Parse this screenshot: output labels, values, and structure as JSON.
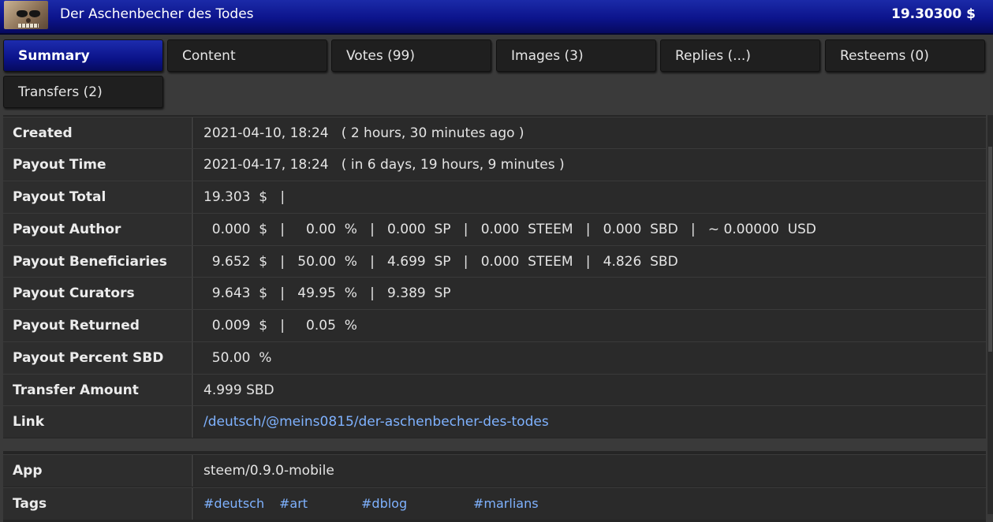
{
  "header": {
    "title": "Der Aschenbecher des Todes",
    "total": "19.30300 $"
  },
  "tabs": [
    {
      "label": "Summary",
      "active": true
    },
    {
      "label": "Content",
      "active": false
    },
    {
      "label": "Votes (99)",
      "active": false
    },
    {
      "label": "Images (3)",
      "active": false
    },
    {
      "label": "Replies (...)",
      "active": false
    },
    {
      "label": "Resteems (0)",
      "active": false
    },
    {
      "label": "Transfers (2)",
      "active": false
    }
  ],
  "summary": [
    {
      "label": "Created",
      "value": "2021-04-10, 18:24   ( 2 hours, 30 minutes ago )"
    },
    {
      "label": "Payout Time",
      "value": "2021-04-17, 18:24   ( in 6 days, 19 hours, 9 minutes )"
    },
    {
      "label": "Payout Total",
      "value": "19.303  $   |"
    },
    {
      "label": "Payout Author",
      "value": "  0.000  $   |     0.00  %   |   0.000  SP   |   0.000  STEEM   |   0.000  SBD   |   ~ 0.00000  USD"
    },
    {
      "label": "Payout Beneficiaries",
      "value": "  9.652  $   |   50.00  %   |   4.699  SP   |   0.000  STEEM   |   4.826  SBD"
    },
    {
      "label": "Payout Curators",
      "value": "  9.643  $   |   49.95  %   |   9.389  SP"
    },
    {
      "label": "Payout Returned",
      "value": "  0.009  $   |     0.05  %"
    },
    {
      "label": "Payout Percent SBD",
      "value": "  50.00  %"
    },
    {
      "label": "Transfer Amount",
      "value": "4.999 SBD"
    },
    {
      "label": "Link",
      "value": "/deutsch/@meins0815/der-aschenbecher-des-todes"
    }
  ],
  "meta": {
    "app_label": "App",
    "app_value": "steem/0.9.0-mobile",
    "tags_label": "Tags",
    "tags": [
      "#deutsch",
      "#art",
      "#dblog",
      "#marlians"
    ]
  },
  "colors": {
    "accent_blue": "#0b138a",
    "link": "#7fb2ff",
    "background": "#3a3a3a"
  }
}
